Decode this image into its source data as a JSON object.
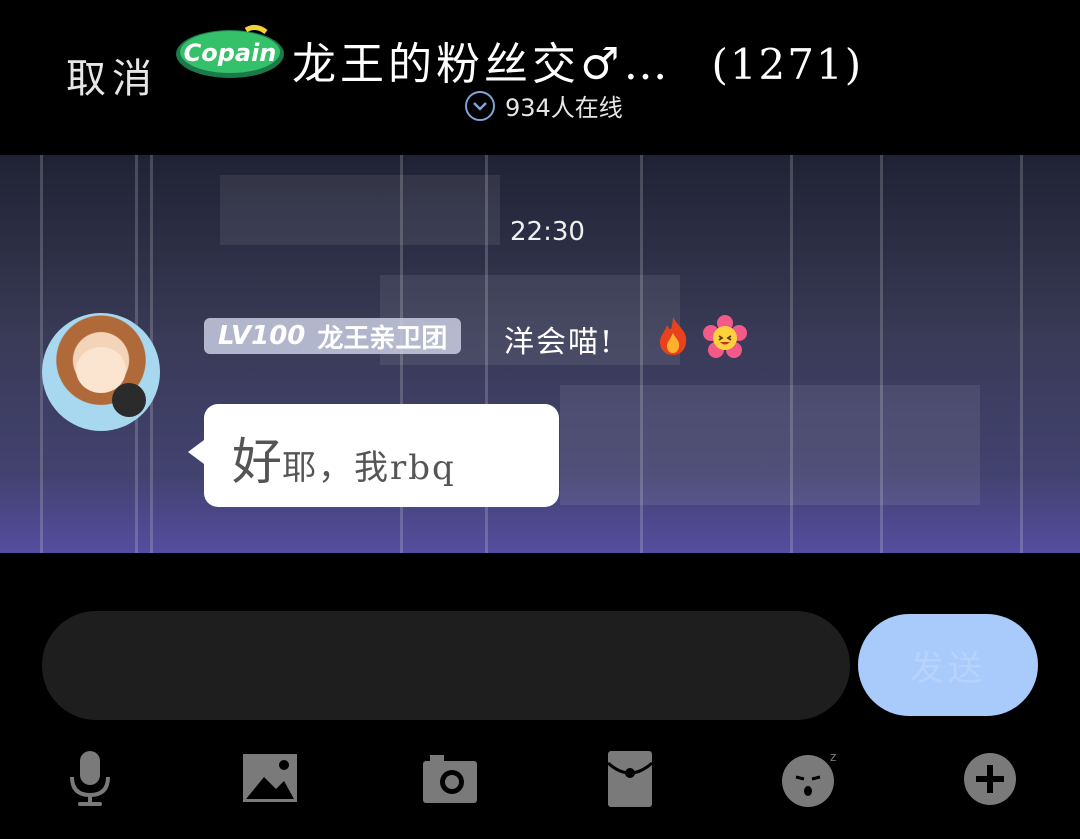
{
  "header": {
    "cancel_label": "取消",
    "group_title": "龙王的粉丝交♂…",
    "member_count": "(1271)",
    "online_text": "934人在线",
    "logo_text": "Copain"
  },
  "chat": {
    "timestamp": "22:30",
    "message": {
      "badge_level": "LV100",
      "badge_title": "龙王亲卫团",
      "sender_name": "洋会喵!",
      "text_big": "好",
      "text_rest": "耶，我rbq",
      "icons": [
        "fire-icon",
        "flower-emoji-icon"
      ]
    }
  },
  "composer": {
    "input_value": "",
    "send_label": "发送"
  },
  "toolbar": {
    "icons": [
      "microphone-icon",
      "image-icon",
      "camera-icon",
      "red-packet-icon",
      "sticker-icon",
      "plus-icon"
    ]
  },
  "colors": {
    "send_button": "#a9cbfb",
    "input_bg": "#1e1e1e",
    "toolbar_icon": "#7a7a7a"
  }
}
